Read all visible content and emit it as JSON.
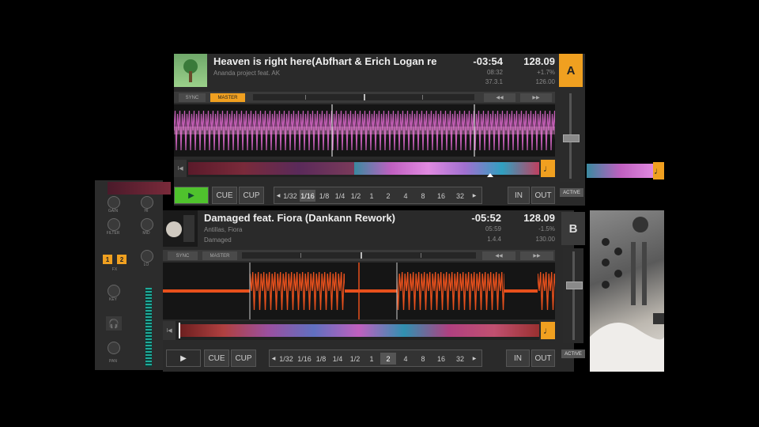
{
  "deck_a": {
    "letter": "A",
    "title": "Heaven is right here(Abfhart & Erich Logan re",
    "artist": "Ananda project feat. AK",
    "remaining": "-03:54",
    "bpm": "128.09",
    "length": "08:32",
    "pitch": "+1.7%",
    "beat_pos": "37.3.1",
    "base_bpm": "126.00",
    "sync_label": "SYNC",
    "master_label": "MASTER",
    "cue_label": "CUE",
    "cup_label": "CUP",
    "in_label": "IN",
    "out_label": "OUT",
    "active_label": "ACTIVE",
    "play_state": "playing",
    "loop_sizes": [
      "1/32",
      "1/16",
      "1/8",
      "1/4",
      "1/2",
      "1",
      "2",
      "4",
      "8",
      "16",
      "32"
    ],
    "selected_loop": "1/16"
  },
  "deck_b": {
    "letter": "B",
    "title": "Damaged feat. Fiora (Dankann Rework)",
    "artist": "Antillas, Fiora",
    "album": "Damaged",
    "remaining": "-05:52",
    "bpm": "128.09",
    "length": "05:59",
    "pitch": "-1.5%",
    "beat_pos": "1.4.4",
    "base_bpm": "130.00",
    "sync_label": "SYNC",
    "master_label": "MASTER",
    "cue_label": "CUE",
    "cup_label": "CUP",
    "in_label": "IN",
    "out_label": "OUT",
    "active_label": "ACTIVE",
    "play_state": "paused",
    "loop_sizes": [
      "1/32",
      "1/16",
      "1/8",
      "1/4",
      "1/2",
      "1",
      "2",
      "4",
      "8",
      "16",
      "32"
    ],
    "selected_loop": "2"
  },
  "mixer": {
    "gain_label": "GAIN",
    "filter_label": "FILTER",
    "fx_label": "FX",
    "fx1": "1",
    "fx2": "2",
    "key_label": "KEY",
    "pan_label": "PAN",
    "hi_label": "HI",
    "mid_label": "MID",
    "lo_label": "LO"
  },
  "colors": {
    "accent": "#f0a020",
    "play_on": "#4fc22d",
    "wave_a": "#e06ad0",
    "wave_b": "#e8501c"
  },
  "icons": [
    "play-icon",
    "headphones-icon",
    "note-icon",
    "back-icon",
    "forward-icon"
  ]
}
